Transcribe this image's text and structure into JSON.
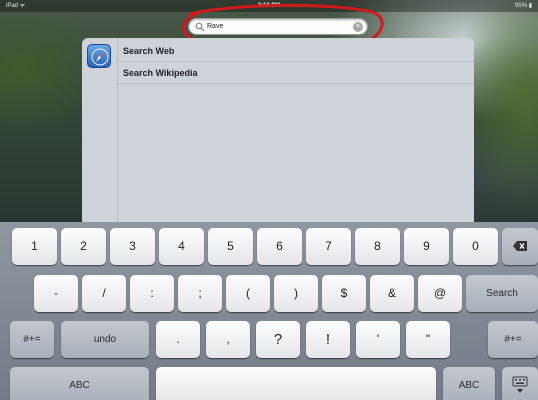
{
  "status_bar": {
    "carrier": "iPad ᯤ",
    "time": "2:19 PM",
    "battery": "95% ▮"
  },
  "search": {
    "value": "Rave",
    "clear_glyph": "×"
  },
  "results": {
    "items": [
      {
        "label": "Search Web",
        "icon": "safari-compass-icon"
      },
      {
        "label": "Search Wikipedia"
      }
    ]
  },
  "keyboard": {
    "row1": [
      "1",
      "2",
      "3",
      "4",
      "5",
      "6",
      "7",
      "8",
      "9",
      "0"
    ],
    "row2": [
      "-",
      "/",
      ":",
      ";",
      "(",
      ")",
      "$",
      "&",
      "@"
    ],
    "row3": [
      ".",
      ",",
      "?",
      "!",
      "'",
      "\""
    ],
    "labels": {
      "symbols_left": "#+=",
      "undo": "undo",
      "symbols_right": "#+=",
      "search": "Search",
      "abc_left": "ABC",
      "abc_right": "ABC",
      "space": ""
    },
    "icons": {
      "delete": "backspace-icon",
      "dismiss": "keyboard-dismiss-icon"
    }
  },
  "colors": {
    "annotation": "#d11a1a",
    "keyboard_bg": "#7f8894",
    "results_bg": "#ced3d9"
  }
}
